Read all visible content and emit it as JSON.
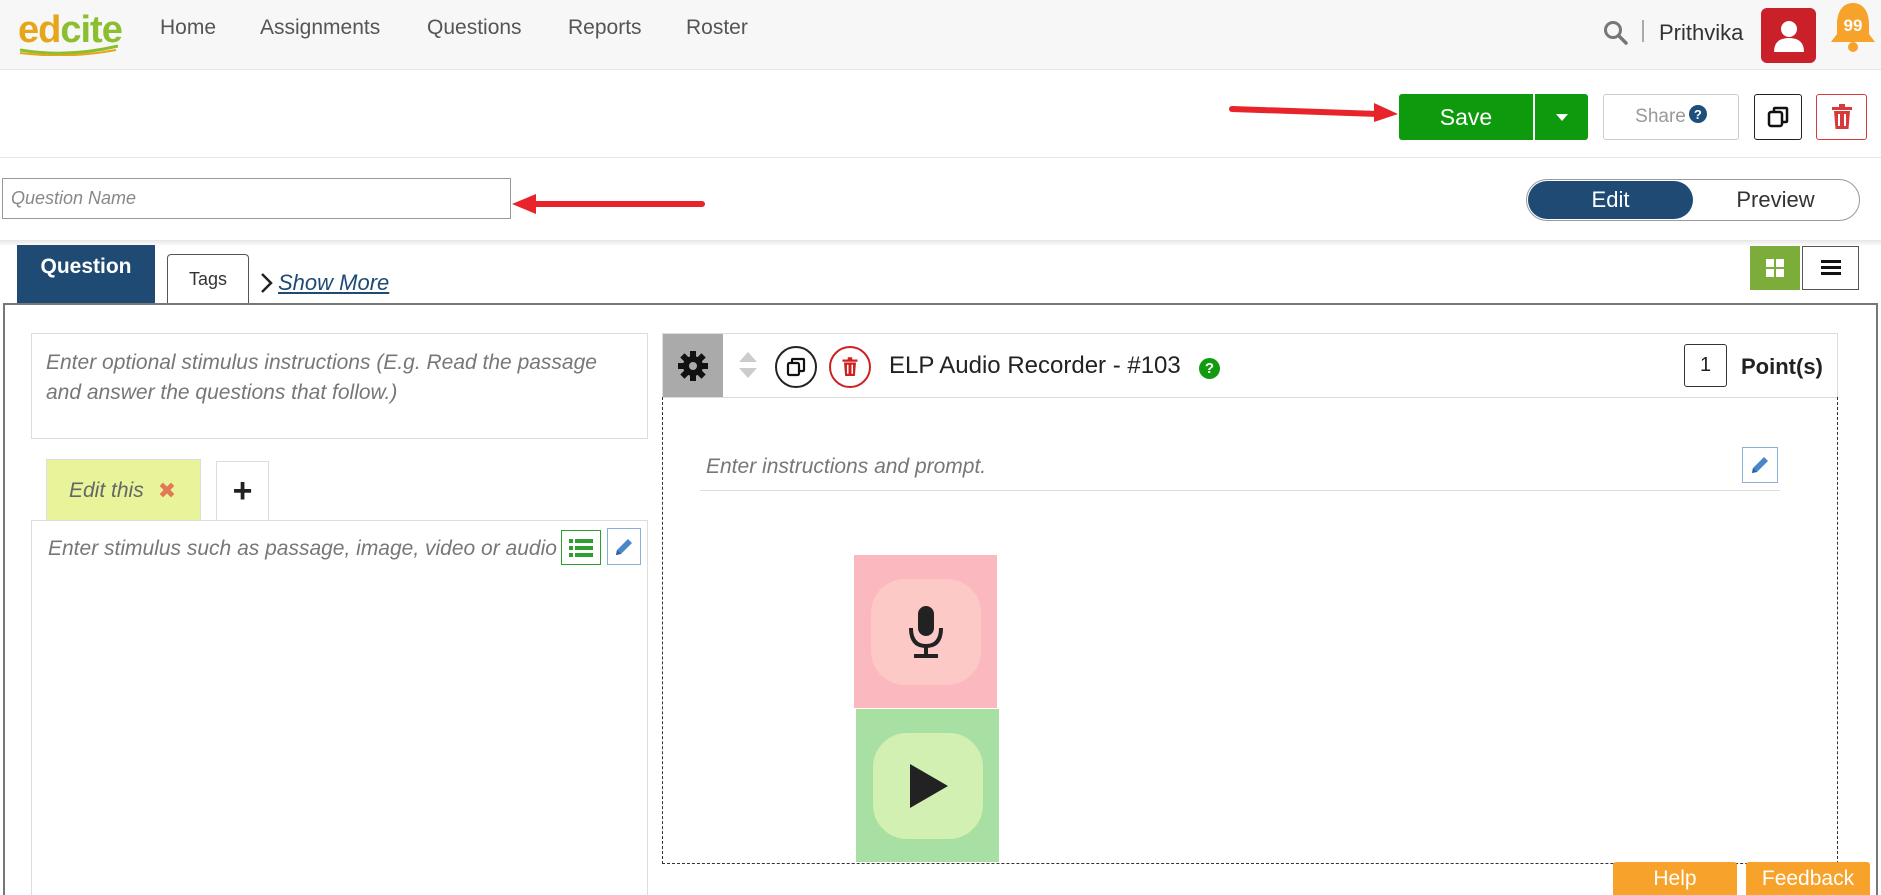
{
  "brand": {
    "logo_part1": "ed",
    "logo_part2": "cite"
  },
  "nav": {
    "items": [
      {
        "label": "Home"
      },
      {
        "label": "Assignments"
      },
      {
        "label": "Questions"
      },
      {
        "label": "Reports"
      },
      {
        "label": "Roster"
      }
    ]
  },
  "user": {
    "name": "Prithvika",
    "notification_count": "99"
  },
  "toolbar": {
    "save_label": "Save",
    "share_label": "Share",
    "share_help": "?"
  },
  "question_name": {
    "placeholder": "Question Name",
    "value": ""
  },
  "mode_toggle": {
    "edit_label": "Edit",
    "preview_label": "Preview",
    "active": "Edit"
  },
  "tabs": {
    "question_label": "Question",
    "tags_label": "Tags",
    "show_more_label": "Show More"
  },
  "stimulus": {
    "instructions_placeholder": "Enter optional stimulus instructions (E.g. Read the passage and answer the questions that follow.)",
    "tab_label": "Edit this",
    "add_tab_label": "+",
    "body_placeholder": "Enter stimulus such as passage, image, video or audio clip"
  },
  "question": {
    "title": "ELP Audio Recorder - #103",
    "help": "?",
    "points_value": "1",
    "points_label": "Point(s)",
    "prompt_placeholder": "Enter instructions and prompt."
  },
  "footer": {
    "help_label": "Help",
    "feedback_label": "Feedback"
  },
  "colors": {
    "primary_navy": "#1e4a74",
    "save_green": "#0d9b0d",
    "accent_orange": "#f7a22a",
    "record_pink": "#fbb8bf",
    "play_green": "#a8e0a3",
    "avatar_red": "#c9202a"
  }
}
